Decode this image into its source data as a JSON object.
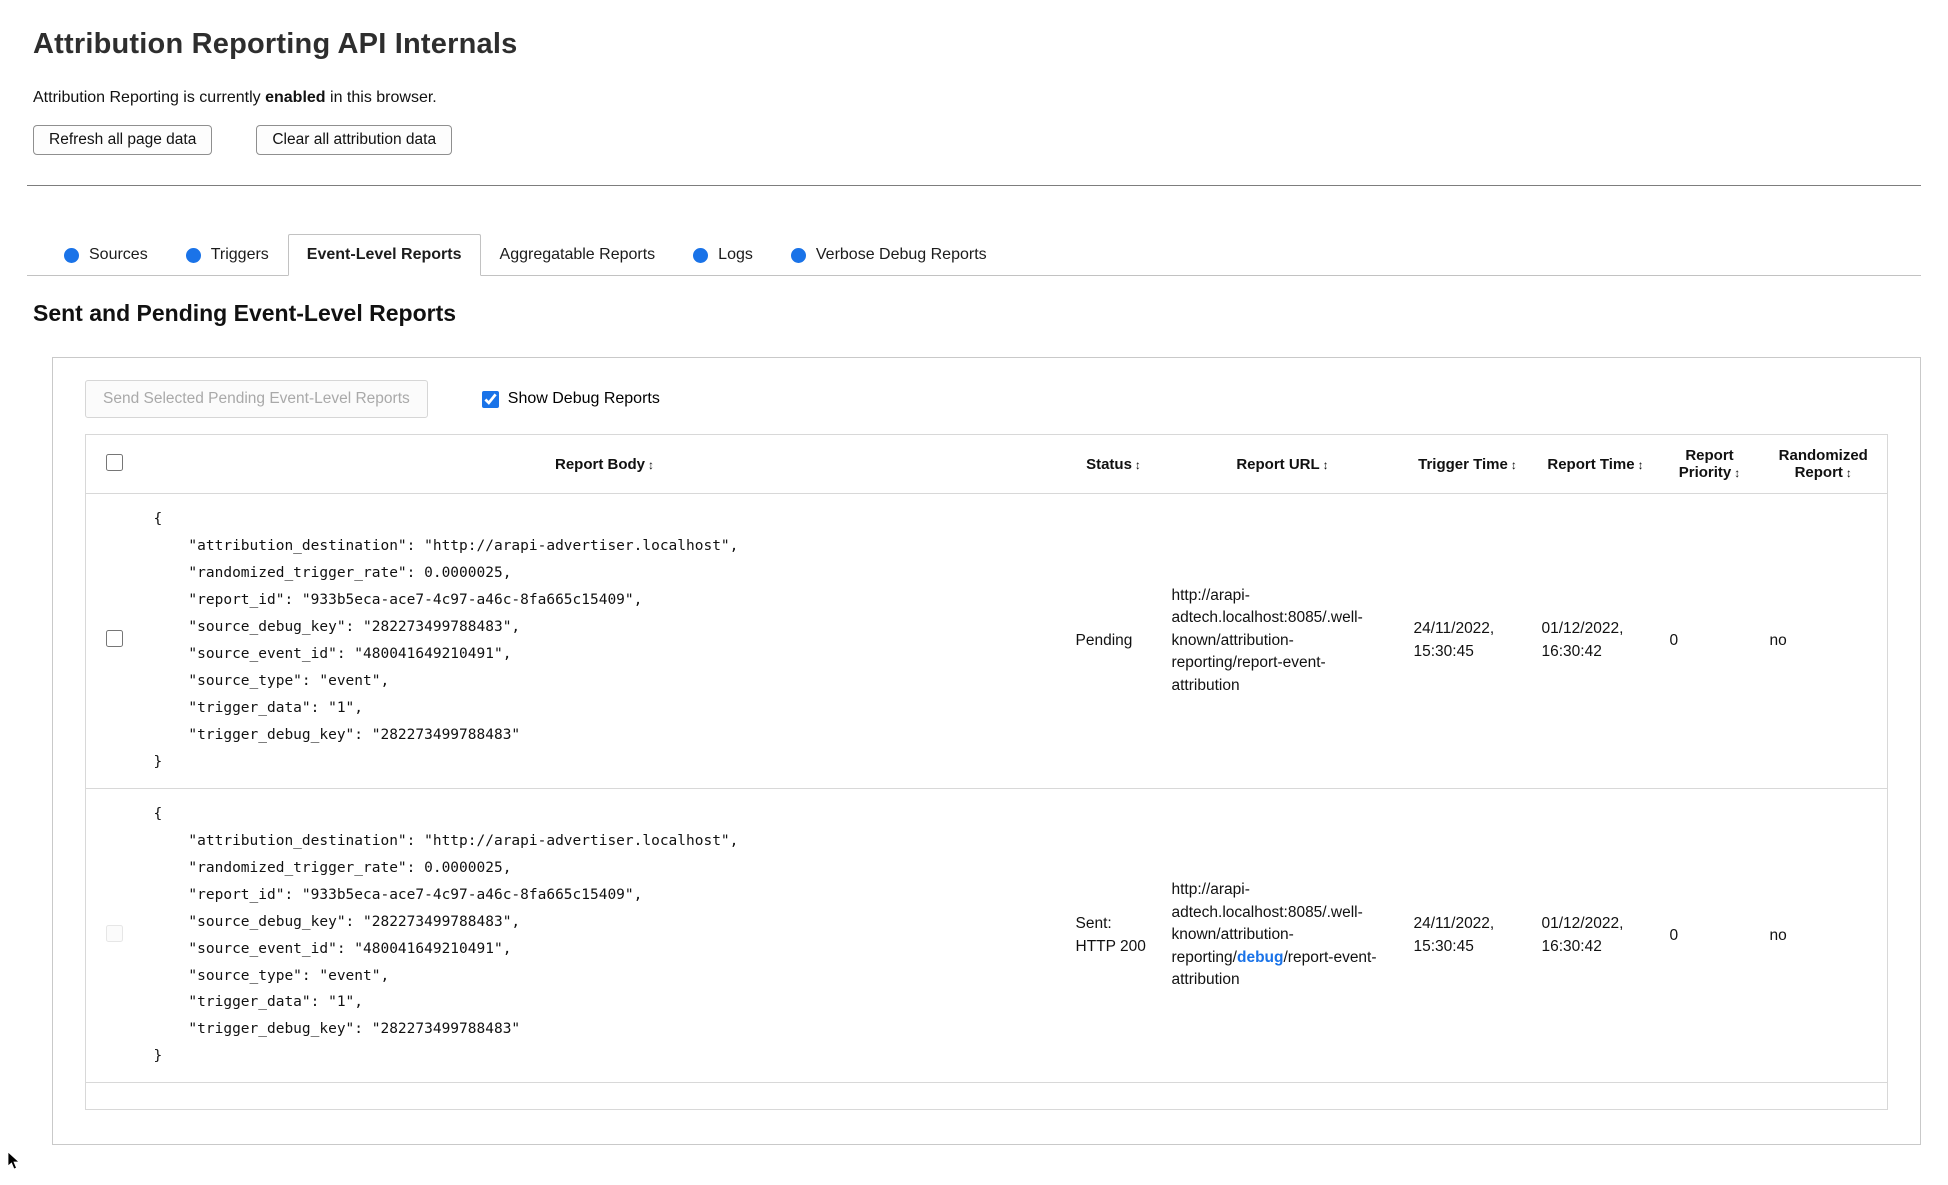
{
  "page": {
    "title": "Attribution Reporting API Internals",
    "status_prefix": "Attribution Reporting is currently ",
    "status_bold": "enabled",
    "status_suffix": " in this browser.",
    "refresh_button": "Refresh all page data",
    "clear_button": "Clear all attribution data"
  },
  "tabs": [
    {
      "label": "Sources",
      "has_dot": true,
      "active": false
    },
    {
      "label": "Triggers",
      "has_dot": true,
      "active": false
    },
    {
      "label": "Event-Level Reports",
      "has_dot": false,
      "active": true
    },
    {
      "label": "Aggregatable Reports",
      "has_dot": false,
      "active": false
    },
    {
      "label": "Logs",
      "has_dot": true,
      "active": false
    },
    {
      "label": "Verbose Debug Reports",
      "has_dot": true,
      "active": false
    }
  ],
  "section": {
    "heading": "Sent and Pending Event-Level Reports",
    "send_selected_button": "Send Selected Pending Event-Level Reports",
    "send_selected_disabled": true,
    "show_debug_label": "Show Debug Reports",
    "show_debug_checked": true
  },
  "table": {
    "sort_icon": "↕",
    "headers": [
      "Report Body",
      "Status",
      "Report URL",
      "Trigger Time",
      "Report Time",
      "Report Priority",
      "Randomized Report"
    ],
    "rows": [
      {
        "body": "{\n    \"attribution_destination\": \"http://arapi-advertiser.localhost\",\n    \"randomized_trigger_rate\": 0.0000025,\n    \"report_id\": \"933b5eca-ace7-4c97-a46c-8fa665c15409\",\n    \"source_debug_key\": \"282273499788483\",\n    \"source_event_id\": \"480041649210491\",\n    \"source_type\": \"event\",\n    \"trigger_data\": \"1\",\n    \"trigger_debug_key\": \"282273499788483\"\n}",
        "status": "Pending",
        "url_prefix": "http://arapi-adtech.localhost:8085/.well-known/attribution-reporting/report-event-attribution",
        "url_highlight": "",
        "url_suffix": "",
        "trigger_time": "24/11/2022, 15:30:45",
        "report_time": "01/12/2022, 16:30:42",
        "report_priority": "0",
        "randomized_report": "no",
        "selectable": true
      },
      {
        "body": "{\n    \"attribution_destination\": \"http://arapi-advertiser.localhost\",\n    \"randomized_trigger_rate\": 0.0000025,\n    \"report_id\": \"933b5eca-ace7-4c97-a46c-8fa665c15409\",\n    \"source_debug_key\": \"282273499788483\",\n    \"source_event_id\": \"480041649210491\",\n    \"source_type\": \"event\",\n    \"trigger_data\": \"1\",\n    \"trigger_debug_key\": \"282273499788483\"\n}",
        "status": "Sent: HTTP 200",
        "url_prefix": "http://arapi-adtech.localhost:8085/.well-known/attribution-reporting/",
        "url_highlight": "debug",
        "url_suffix": "/report-event-attribution",
        "trigger_time": "24/11/2022, 15:30:45",
        "report_time": "01/12/2022, 16:30:42",
        "report_priority": "0",
        "randomized_report": "no",
        "selectable": false
      }
    ]
  },
  "colors": {
    "accent_blue": "#1a73e8"
  }
}
